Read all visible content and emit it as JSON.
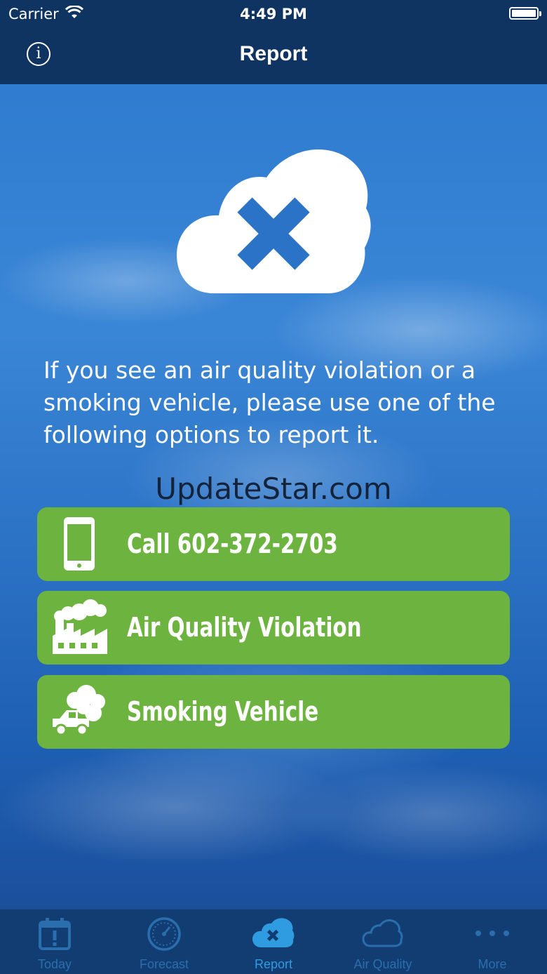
{
  "status_bar": {
    "carrier": "Carrier",
    "time": "4:49 PM"
  },
  "nav": {
    "title": "Report",
    "info_icon": "info-icon"
  },
  "hero": {
    "icon": "cloud-x-icon"
  },
  "intro_text": "If you see an air quality violation or a smoking vehicle, please use one of the following options to report it.",
  "watermark": "UpdateStar.com",
  "actions": [
    {
      "label": "Call 602-372-2703",
      "icon": "phone-icon"
    },
    {
      "label": "Air Quality Violation",
      "icon": "factory-icon"
    },
    {
      "label": "Smoking Vehicle",
      "icon": "smoking-truck-icon"
    }
  ],
  "colors": {
    "action_green": "#6db33f",
    "nav_bg": "#0f3461",
    "tab_inactive": "#2b6eae",
    "tab_active": "#2f9be0"
  },
  "tabs": [
    {
      "label": "Today",
      "icon": "calendar-alert-icon",
      "active": false
    },
    {
      "label": "Forecast",
      "icon": "gauge-icon",
      "active": false
    },
    {
      "label": "Report",
      "icon": "cloud-x-icon",
      "active": true
    },
    {
      "label": "Air Quality",
      "icon": "cloud-icon",
      "active": false
    },
    {
      "label": "More",
      "icon": "more-icon",
      "active": false
    }
  ]
}
